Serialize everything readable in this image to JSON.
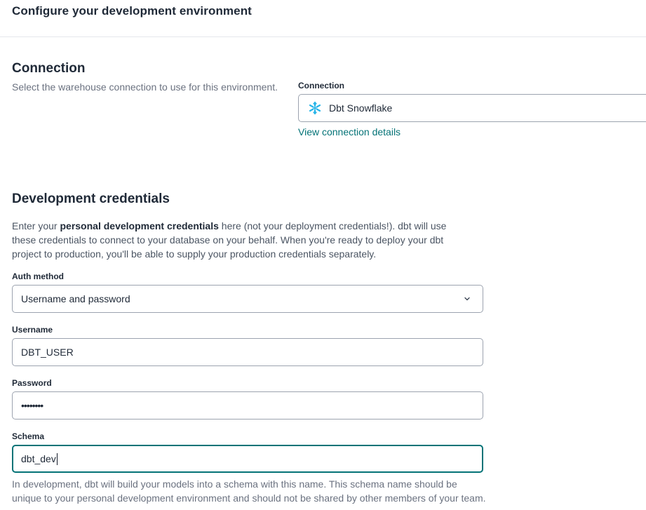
{
  "page": {
    "title": "Configure your development environment"
  },
  "connection": {
    "title": "Connection",
    "description": "Select the warehouse connection to use for this environment.",
    "field_label": "Connection",
    "selected_value": "Dbt Snowflake",
    "selected_icon": "snowflake-icon",
    "link_label": "View connection details",
    "icon_color": "#29b5e8",
    "link_color": "#047377"
  },
  "credentials": {
    "title": "Development credentials",
    "desc_prefix": "Enter your ",
    "desc_bold": "personal development credentials",
    "desc_suffix": " here (not your deployment credentials!). dbt will use these credentials to connect to your database on your behalf. When you're ready to deploy your dbt project to production, you'll be able to supply your production credentials separately.",
    "auth_method": {
      "label": "Auth method",
      "value": "Username and password",
      "icon": "chevron-down-icon"
    },
    "username": {
      "label": "Username",
      "value": "DBT_USER"
    },
    "password": {
      "label": "Password",
      "value": "••••••••"
    },
    "schema": {
      "label": "Schema",
      "value": "dbt_dev",
      "help": "In development, dbt will build your models into a schema with this name. This schema name should be unique to your personal development environment and should not be shared by other members of your team.",
      "focus_color": "#047377"
    }
  }
}
